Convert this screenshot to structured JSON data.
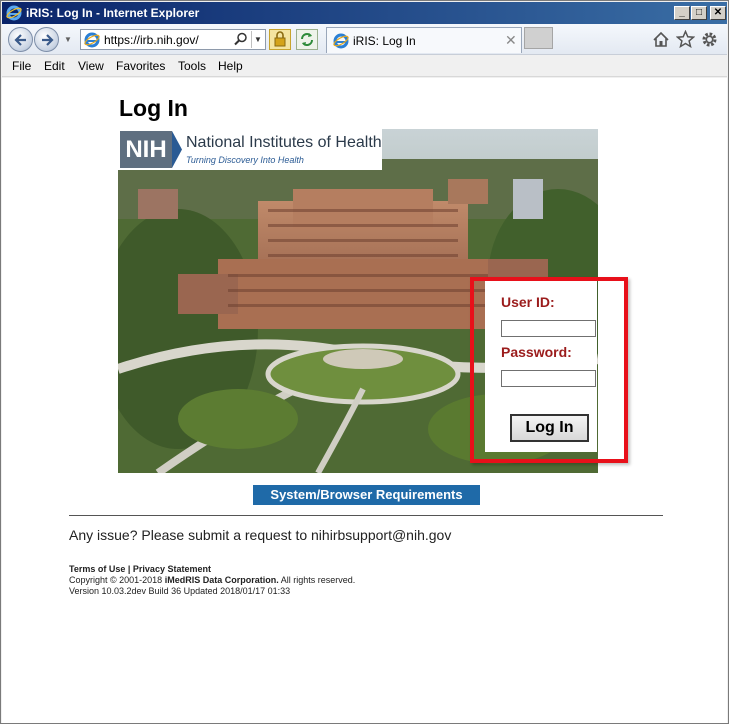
{
  "window": {
    "title": "iRIS: Log In - Internet Explorer",
    "controls": {
      "minimize": "_",
      "maximize": "□",
      "close": "✕"
    }
  },
  "address_bar": {
    "url": "https://irb.nih.gov/"
  },
  "tab": {
    "title": "iRIS: Log In",
    "close": "✕"
  },
  "menu": [
    "File",
    "Edit",
    "View",
    "Favorites",
    "Tools",
    "Help"
  ],
  "page": {
    "heading": "Log In",
    "banner": {
      "abbr": "NIH",
      "name": "National Institutes of Health",
      "tagline": "Turning Discovery Into Health"
    },
    "login": {
      "user_label": "User ID:",
      "user_value": "",
      "password_label": "Password:",
      "password_value": "",
      "button": "Log In"
    },
    "sysreq_link": "System/Browser Requirements",
    "issue_text": "Any issue? Please submit a request to nihirbsupport@nih.gov",
    "footer": {
      "terms": "Terms of Use",
      "separator": "|",
      "privacy": "Privacy Statement",
      "copyright_prefix": "Copyright © 2001-2018",
      "company": "iMedRIS Data Corporation.",
      "rights": "All rights reserved.",
      "version": "Version 10.03.2dev Build 36 Updated 2018/01/17 01:33"
    }
  },
  "colors": {
    "title_bar": "#0a246a",
    "label_red": "#9b1c1c",
    "highlight_red": "#e8101a",
    "link_blue": "#1f6aa8"
  },
  "icons": [
    "ie-icon",
    "back-icon",
    "forward-icon",
    "search-icon",
    "lock-icon",
    "refresh-icon",
    "home-icon",
    "star-icon",
    "gear-icon"
  ]
}
